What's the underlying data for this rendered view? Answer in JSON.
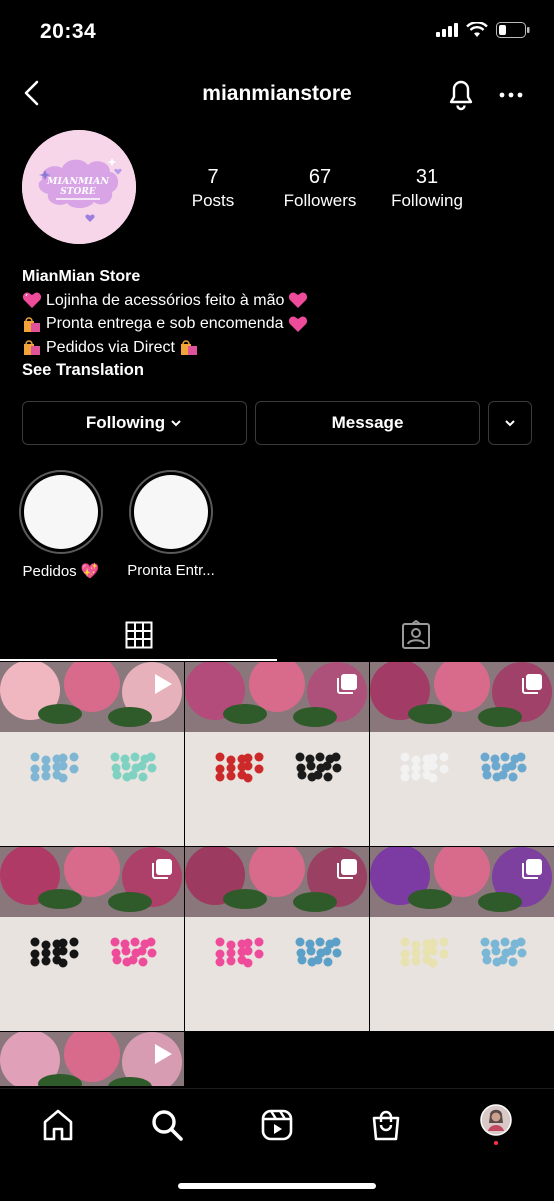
{
  "status_bar": {
    "time": "20:34"
  },
  "header": {
    "username": "mianmianstore"
  },
  "profile": {
    "avatar_text": "MIANMIAN STORE",
    "stats": [
      {
        "value": "7",
        "label": "Posts"
      },
      {
        "value": "67",
        "label": "Followers"
      },
      {
        "value": "31",
        "label": "Following"
      }
    ],
    "bio": {
      "name": "MianMian Store",
      "lines": [
        "Lojinha de acessórios feito à mão",
        "Pronta entrega e sob encomenda",
        "Pedidos via Direct"
      ],
      "see_translation": "See Translation"
    }
  },
  "actions": {
    "following_label": "Following",
    "message_label": "Message"
  },
  "highlights": [
    {
      "label": "Pedidos 💖"
    },
    {
      "label": "Pronta Entr..."
    }
  ],
  "tabs": [
    {
      "icon": "grid-icon",
      "active": true
    },
    {
      "icon": "tagged-icon",
      "active": false
    }
  ],
  "posts": [
    {
      "type": "reel",
      "colors": [
        "#e9e4df",
        "#7fb6d3",
        "#7fd2c2",
        "#f1b7c1"
      ]
    },
    {
      "type": "multi",
      "colors": [
        "#e8e3de",
        "#cc2a2a",
        "#1b1b1b",
        "#b34c7a"
      ]
    },
    {
      "type": "multi",
      "colors": [
        "#e8e3de",
        "#f2f2f2",
        "#6aa8cf",
        "#a23b66"
      ]
    },
    {
      "type": "multi",
      "colors": [
        "#e8e3de",
        "#151515",
        "#ee4c9a",
        "#b03a66"
      ]
    },
    {
      "type": "multi",
      "colors": [
        "#e8e3de",
        "#ee4c9a",
        "#5aa0c8",
        "#9c3a60"
      ]
    },
    {
      "type": "multi",
      "colors": [
        "#e8e3de",
        "#e8e2b0",
        "#7ab7d6",
        "#7c3aa3"
      ]
    },
    {
      "type": "reel",
      "colors": [
        "#e8e3de",
        "#c43a5a",
        "#7c3aa3",
        "#e0a0b8"
      ]
    }
  ],
  "bottom_nav": [
    "home-icon",
    "search-icon",
    "reels-icon",
    "shop-icon",
    "profile-avatar"
  ]
}
